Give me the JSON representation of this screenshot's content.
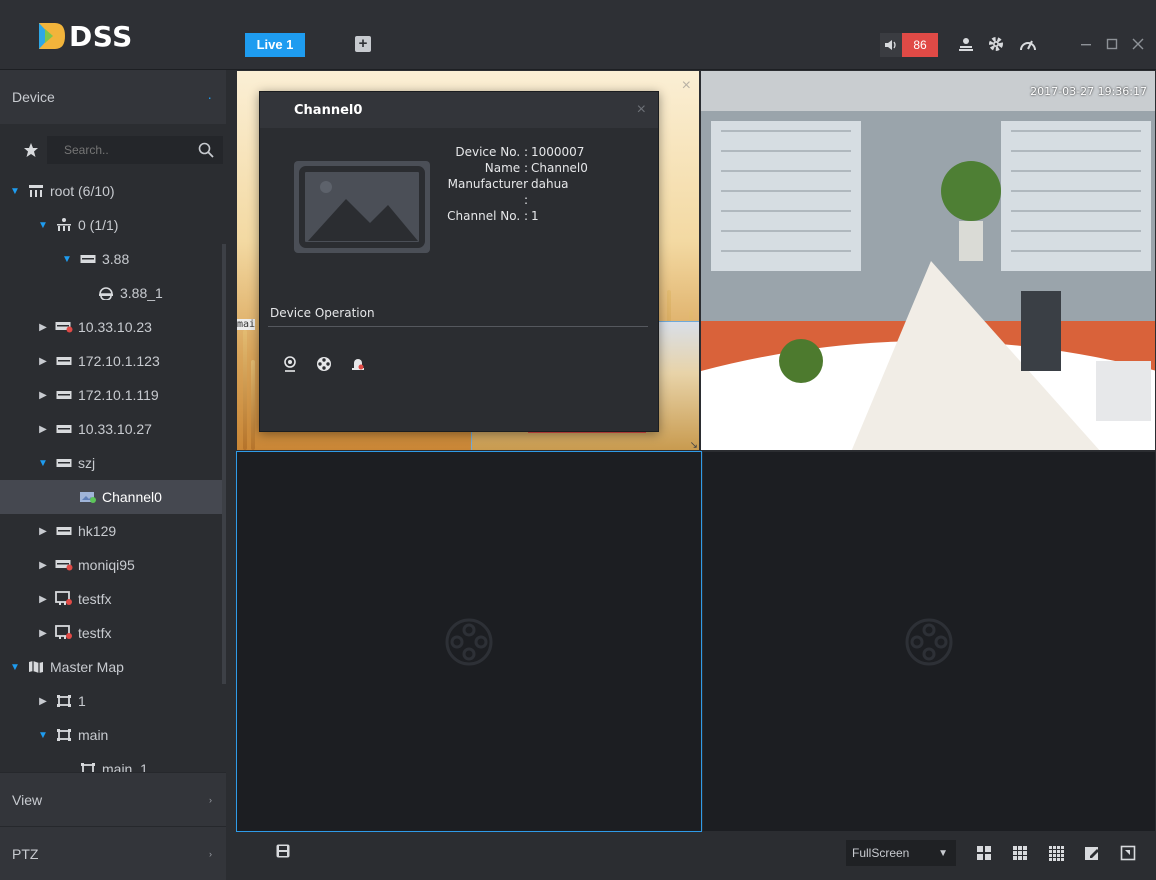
{
  "app": {
    "logo_text": "DSS"
  },
  "tabs": [
    {
      "label": "Live 1"
    }
  ],
  "alarm": {
    "count": "86"
  },
  "sidebar": {
    "device_label": "Device",
    "search_placeholder": "Search..",
    "tree": [
      {
        "label": "root (6/10)"
      },
      {
        "label": "0 (1/1)"
      },
      {
        "label": "3.88"
      },
      {
        "label": "3.88_1"
      },
      {
        "label": "10.33.10.23"
      },
      {
        "label": "172.10.1.123"
      },
      {
        "label": "172.10.1.119"
      },
      {
        "label": "10.33.10.27"
      },
      {
        "label": "szj"
      },
      {
        "label": "Channel0"
      },
      {
        "label": "hk129"
      },
      {
        "label": "moniqi95"
      },
      {
        "label": "testfx"
      },
      {
        "label": "testfx"
      },
      {
        "label": "Master Map"
      },
      {
        "label": "1"
      },
      {
        "label": "main"
      },
      {
        "label": "main_1"
      }
    ],
    "view_label": "View",
    "ptz_label": "PTZ"
  },
  "video": {
    "timestamp": "2017-03-27 19:36:17",
    "stray_text": "mai"
  },
  "popup": {
    "title": "Channel0",
    "device_no_label": "Device No. :",
    "device_no": "1000007",
    "name_label": "Name :",
    "name": "Channel0",
    "manufacturer_label": "Manufacturer :",
    "manufacturer": "dahua",
    "channel_no_label": "Channel No. :",
    "channel_no": "1",
    "device_operation": "Device Operation"
  },
  "bottombar": {
    "fullscreen_label": "FullScreen"
  },
  "colors": {
    "accent": "#1e9cf0",
    "alarm": "#e04a46",
    "panel": "#2b2d31"
  }
}
